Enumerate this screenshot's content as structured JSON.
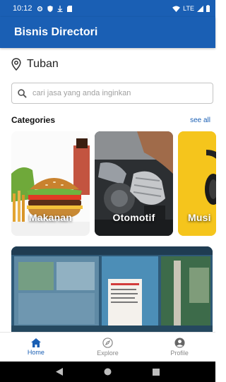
{
  "status_bar": {
    "time": "10:12",
    "network": "LTE"
  },
  "app_bar": {
    "title": "Bisnis Directori"
  },
  "location": {
    "label": "Tuban",
    "icon": "location-pin-icon"
  },
  "search": {
    "placeholder": "cari jasa yang anda inginkan",
    "icon": "search-icon"
  },
  "categories_section": {
    "title": "Categories",
    "see_all": "see all",
    "items": [
      {
        "label": "Makanan"
      },
      {
        "label": "Otomotif"
      },
      {
        "label": "Musi"
      }
    ]
  },
  "bottom_nav": {
    "items": [
      {
        "label": "Home",
        "icon": "home-icon",
        "active": true
      },
      {
        "label": "Explore",
        "icon": "compass-icon",
        "active": false
      },
      {
        "label": "Profile",
        "icon": "profile-icon",
        "active": false
      }
    ]
  },
  "colors": {
    "primary": "#1a5fb4",
    "inactive": "#888888"
  }
}
